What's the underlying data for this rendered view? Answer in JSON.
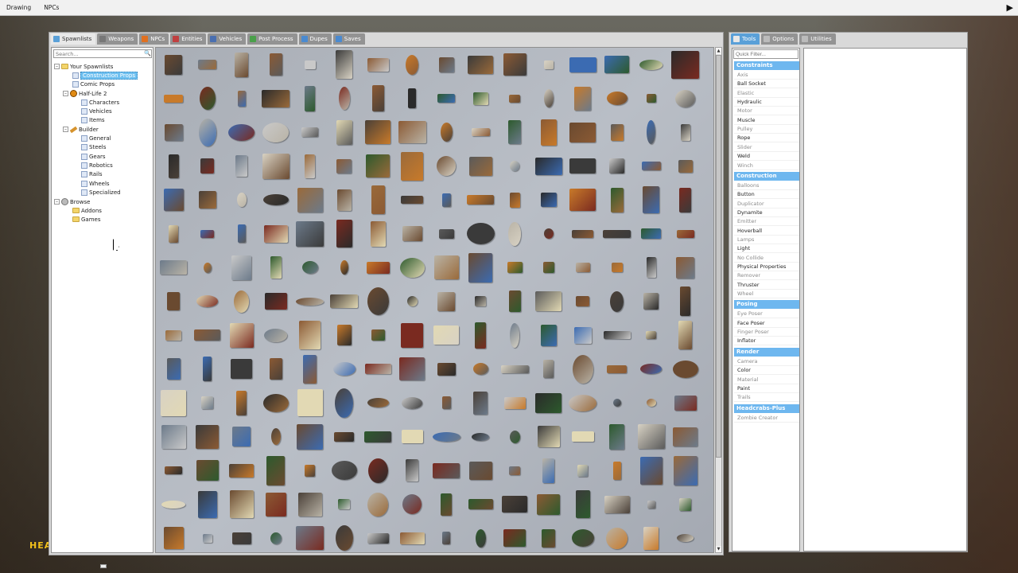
{
  "menubar": {
    "items": [
      "Drawing",
      "NPCs"
    ]
  },
  "hud": {
    "text": "HEA"
  },
  "spawn_tabs": [
    {
      "label": "Spawnlists",
      "color": "#5aa0d8"
    },
    {
      "label": "Weapons",
      "color": "#777777"
    },
    {
      "label": "NPCs",
      "color": "#e07020"
    },
    {
      "label": "Entities",
      "color": "#c04040"
    },
    {
      "label": "Vehicles",
      "color": "#4a6fb0"
    },
    {
      "label": "Post Process",
      "color": "#4aa04a"
    },
    {
      "label": "Dupes",
      "color": "#4a8ad0"
    },
    {
      "label": "Saves",
      "color": "#4a8ad0"
    }
  ],
  "tree": {
    "search_placeholder": "Search...",
    "your_spawnlists": "Your Spawnlists",
    "construction_props": "Construction Props",
    "comic_props": "Comic Props",
    "half_life_2": "Half-Life 2",
    "characters": "Characters",
    "vehicles": "Vehicles",
    "items": "Items",
    "builder": "Builder",
    "general": "General",
    "steels": "Steels",
    "gears": "Gears",
    "robotics": "Robotics",
    "rails": "Rails",
    "wheels": "Wheels",
    "specialized": "Specialized",
    "browse": "Browse",
    "addons": "Addons",
    "games": "Games"
  },
  "tool_tabs": [
    {
      "label": "Tools"
    },
    {
      "label": "Options"
    },
    {
      "label": "Utilities"
    }
  ],
  "tool_filter_placeholder": "Quick Filter...",
  "tool_categories": [
    {
      "name": "Constraints",
      "items": [
        {
          "label": "Axis",
          "dim": true
        },
        {
          "label": "Ball Socket",
          "dim": false
        },
        {
          "label": "Elastic",
          "dim": true
        },
        {
          "label": "Hydraulic",
          "dim": false
        },
        {
          "label": "Motor",
          "dim": true
        },
        {
          "label": "Muscle",
          "dim": false
        },
        {
          "label": "Pulley",
          "dim": true
        },
        {
          "label": "Rope",
          "dim": false
        },
        {
          "label": "Slider",
          "dim": true
        },
        {
          "label": "Weld",
          "dim": false
        },
        {
          "label": "Winch",
          "dim": true
        }
      ]
    },
    {
      "name": "Construction",
      "items": [
        {
          "label": "Balloons",
          "dim": true
        },
        {
          "label": "Button",
          "dim": false
        },
        {
          "label": "Duplicator",
          "dim": true
        },
        {
          "label": "Dynamite",
          "dim": false
        },
        {
          "label": "Emitter",
          "dim": true
        },
        {
          "label": "Hoverball",
          "dim": false
        },
        {
          "label": "Lamps",
          "dim": true
        },
        {
          "label": "Light",
          "dim": false
        },
        {
          "label": "No Collide",
          "dim": true
        },
        {
          "label": "Physical Properties",
          "dim": false
        },
        {
          "label": "Remover",
          "dim": true
        },
        {
          "label": "Thruster",
          "dim": false
        },
        {
          "label": "Wheel",
          "dim": true
        }
      ]
    },
    {
      "name": "Posing",
      "items": [
        {
          "label": "Eye Poser",
          "dim": true
        },
        {
          "label": "Face Poser",
          "dim": false
        },
        {
          "label": "Finger Poser",
          "dim": true
        },
        {
          "label": "Inflator",
          "dim": false
        }
      ]
    },
    {
      "name": "Render",
      "items": [
        {
          "label": "Camera",
          "dim": true
        },
        {
          "label": "Color",
          "dim": false
        },
        {
          "label": "Material",
          "dim": true
        },
        {
          "label": "Paint",
          "dim": false
        },
        {
          "label": "Trails",
          "dim": true
        }
      ]
    },
    {
      "name": "Headcrabs-Plus",
      "items": [
        {
          "label": "Zombie Creator",
          "dim": true
        }
      ]
    }
  ],
  "prop_palette": [
    "#4a4038",
    "#6a4a30",
    "#8b5a34",
    "#3a3a3a",
    "#2d5a2d",
    "#c87a2a",
    "#d8d2c4",
    "#3b6bb2",
    "#5a5a5a",
    "#9a6a3a",
    "#b9b3a6",
    "#7a2a20",
    "#e2d9b4",
    "#2a2a2a",
    "#6c7a8a",
    "#c9c9c9"
  ]
}
